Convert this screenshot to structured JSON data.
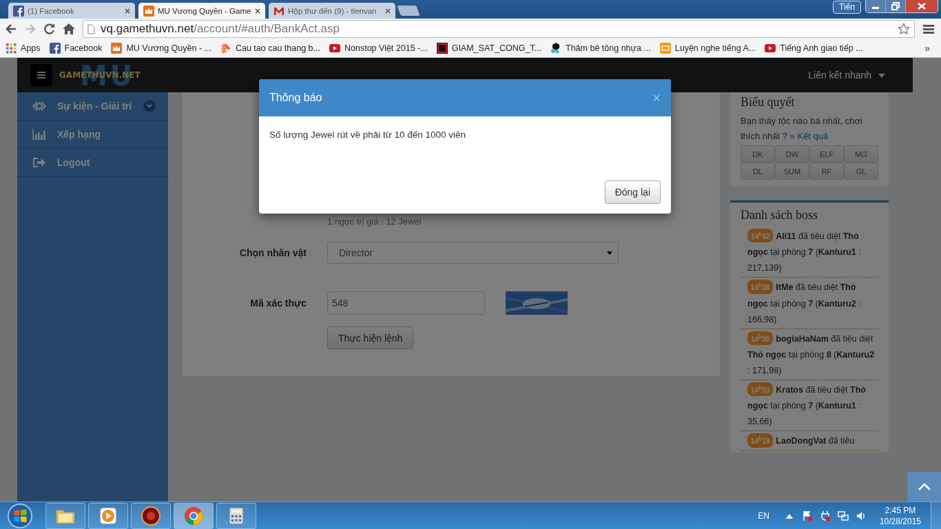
{
  "browser": {
    "tabs": [
      {
        "kind": "facebook",
        "title": "(1) Facebook",
        "selected": false
      },
      {
        "kind": "mu",
        "title": "MU Vương Quyền - Game",
        "selected": true
      },
      {
        "kind": "gmail",
        "title": "Hộp thư đến (9) - tienvan",
        "selected": false
      }
    ],
    "profile": "Tiến",
    "url": {
      "host": "vq.gamethuvn.net",
      "path": "/account/#auth/BankAct.asp"
    },
    "bookmarks": [
      {
        "kind": "apps",
        "label": "Apps"
      },
      {
        "kind": "facebook",
        "label": "Facebook"
      },
      {
        "kind": "mu",
        "label": "MU Vương Quyền - ..."
      },
      {
        "kind": "stripes",
        "label": "Cau tao cau thang b..."
      },
      {
        "kind": "video",
        "label": "Nonstop Việt 2015 -..."
      },
      {
        "kind": "square",
        "label": "GIAM_SAT_CONG_T..."
      },
      {
        "kind": "hexagon",
        "label": "Thảm bê tông nhựa ..."
      },
      {
        "kind": "number",
        "label": "Luyện nghe tiếng A..."
      },
      {
        "kind": "video",
        "label": "Tiếng Anh giao tiếp ..."
      }
    ],
    "bookmarks_more": "»"
  },
  "site": {
    "logo": {
      "mark": "MU",
      "text": "GAMETHUVN.NET"
    },
    "quick_links": "Liên kết nhanh",
    "sidebar": [
      {
        "kind": "events",
        "label": "Sự kiện - Giải trí",
        "expandable": true
      },
      {
        "kind": "ranking",
        "label": "Xếp hạng",
        "expandable": false
      },
      {
        "kind": "logout",
        "label": "Logout",
        "expandable": false
      }
    ],
    "form": {
      "rate_note": "1 ngọc trị giá : 12 Jewel",
      "character_label": "Chọn nhân vật",
      "character_value": "Director",
      "captcha_label": "Mã xác thực",
      "captcha_value": "548",
      "submit": "Thực hiện lệnh"
    },
    "poll": {
      "title": "Biểu quyết",
      "question": "Bạn thấy tộc nào bá nhất, chơi thích nhất ?",
      "results_link": "» Kết quả",
      "options": [
        "DK",
        "DW",
        "ELF",
        "MG",
        "DL",
        "SUM",
        "RF",
        "GL"
      ]
    },
    "boss_list": {
      "title": "Danh sách boss",
      "entries": [
        {
          "time": "14$^{h}$42",
          "text": "**Ali11** đã tiêu diệt **Thỏ ngọc** tại phòng **7** (**Kanturu1** : 217,139)"
        },
        {
          "time": "14$^{h}$38",
          "text": "**ItMe** đã tiêu diệt **Thỏ ngọc** tại phòng **7** (**Kanturu2** : 166,98)"
        },
        {
          "time": "14$^{h}$30",
          "text": "**bogiaHaNam** đã tiêu diệt **Thỏ ngọc** tại phòng **8** (**Kanturu2** : 171,98)"
        },
        {
          "time": "14$^{h}$23",
          "text": "**Kratos** đã tiêu diệt **Thỏ ngọc** tại phòng **7** (**Kanturu1** : 35,66)"
        },
        {
          "time": "14$^{h}$19",
          "text": "**LaoDongVat** đã tiêu"
        }
      ]
    }
  },
  "modal": {
    "title": "Thông báo",
    "close": "×",
    "message": "Số lượng Jewel rút về phải từ 10 đến 1000 viên",
    "button": "Đóng lại"
  },
  "taskbar": {
    "apps": [
      {
        "kind": "explorer",
        "selected": false
      },
      {
        "kind": "media",
        "selected": false
      },
      {
        "kind": "game",
        "selected": false
      },
      {
        "kind": "chrome",
        "selected": true
      },
      {
        "kind": "calculator",
        "selected": false
      }
    ],
    "language": "EN",
    "time": "2:45 PM",
    "date": "10/28/2015"
  }
}
